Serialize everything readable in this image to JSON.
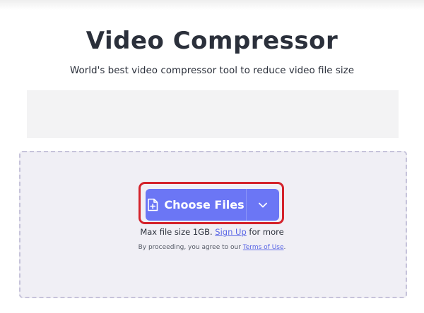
{
  "page": {
    "title": "Video Compressor",
    "subtitle": "World's best video compressor tool to reduce video file size"
  },
  "upload": {
    "choose_label": "Choose Files",
    "limit_prefix": "Max file size 1GB.",
    "signup_link": "Sign Up",
    "limit_suffix": "for more",
    "terms_prefix": "By proceeding, you agree to our",
    "terms_link": "Terms of Use",
    "terms_suffix": "."
  },
  "icons": {
    "file_add": "file-plus-icon",
    "dropdown": "chevron-down-icon"
  },
  "colors": {
    "button_bg": "#6b76f5",
    "highlight": "#d4222b",
    "link": "#5a67e6",
    "dropzone_bg": "#f0eff5",
    "dropzone_border": "#c6c3da"
  }
}
